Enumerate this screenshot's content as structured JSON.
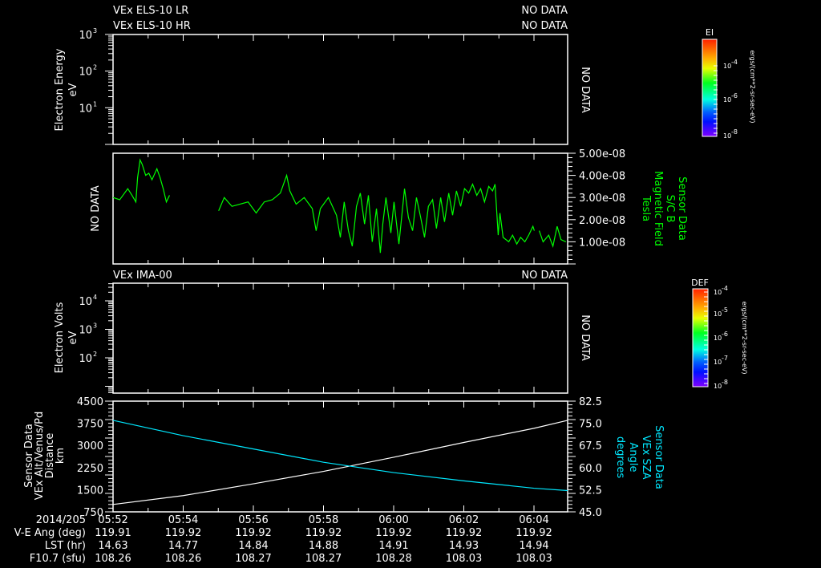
{
  "colors": {
    "background": "#000000",
    "axis": "#ffffff",
    "bfield": "#00ff00",
    "sza": "#00e8ff",
    "altitude": "#ffffff"
  },
  "panel1": {
    "title1": "VEx ELS-10 LR",
    "status1": "NO DATA",
    "title2": "VEx ELS-10 HR",
    "status2": "NO DATA",
    "ylabel": "Electron Energy",
    "yunit": "eV",
    "yticks": [
      {
        "base": "10",
        "exp": "3",
        "value": 1000
      },
      {
        "base": "10",
        "exp": "2",
        "value": 100
      },
      {
        "base": "10",
        "exp": "1",
        "value": 10
      }
    ],
    "ylim": [
      1,
      1000
    ],
    "nodata": "NO DATA",
    "colorbar": {
      "title": "EI",
      "unit": "ergs/(cm**2-sr-sec-eV)",
      "ticks": [
        {
          "base": "10",
          "exp": "-4"
        },
        {
          "base": "10",
          "exp": "-6"
        },
        {
          "base": "10",
          "exp": "-8"
        }
      ]
    }
  },
  "panel2": {
    "nodata_left": "NO DATA",
    "ylabels": [
      "Sensor Data",
      "S/C B",
      "Magnetic Field",
      "Tesla"
    ],
    "yticks": [
      "5.00e-08",
      "4.00e-08",
      "3.00e-08",
      "2.00e-08",
      "1.00e-08"
    ],
    "ytick_values": [
      5e-08,
      4e-08,
      3e-08,
      2e-08,
      1e-08
    ]
  },
  "panel3": {
    "title": "VEx IMA-00",
    "status": "NO DATA",
    "ylabel": "Electron Volts",
    "yunit": "eV",
    "yticks": [
      {
        "base": "10",
        "exp": "4",
        "value": 10000
      },
      {
        "base": "10",
        "exp": "3",
        "value": 1000
      },
      {
        "base": "10",
        "exp": "2",
        "value": 100
      }
    ],
    "nodata": "NO DATA",
    "colorbar": {
      "title": "DEF",
      "unit": "ergs/(cm**2-sr-sec-eV)",
      "ticks": [
        {
          "base": "10",
          "exp": "-4"
        },
        {
          "base": "10",
          "exp": "-5"
        },
        {
          "base": "10",
          "exp": "-6"
        },
        {
          "base": "10",
          "exp": "-7"
        },
        {
          "base": "10",
          "exp": "-8"
        }
      ]
    }
  },
  "panel4": {
    "ylabels_left": [
      "Sensor Data",
      "VEx Alt/Venus/Pd",
      "Distance",
      "km"
    ],
    "ylabels_right": [
      "Sensor Data",
      "VEx SZA",
      "Angle",
      "degrees"
    ],
    "yticks_left": [
      "4500",
      "3750",
      "3000",
      "2250",
      "1500",
      "750"
    ],
    "yticks_right": [
      "82.5",
      "75.0",
      "67.5",
      "60.0",
      "52.5",
      "45.0"
    ]
  },
  "xaxis": {
    "row_labels": [
      "2014/205",
      "V-E Ang (deg)",
      "LST (hr)",
      "F10.7 (sfu)"
    ],
    "times": [
      "05:52",
      "05:54",
      "05:56",
      "05:58",
      "06:00",
      "06:02",
      "06:04"
    ],
    "ve_ang": [
      "119.91",
      "119.92",
      "119.92",
      "119.92",
      "119.92",
      "119.92",
      "119.92"
    ],
    "lst": [
      "14.63",
      "14.77",
      "14.84",
      "14.88",
      "14.91",
      "14.93",
      "14.94"
    ],
    "f107": [
      "108.26",
      "108.26",
      "108.27",
      "108.27",
      "108.28",
      "108.03",
      "108.03"
    ]
  },
  "chart_data": [
    {
      "type": "heatmap",
      "title": "VEx ELS-10 LR / HR",
      "ylabel": "Electron Energy (eV)",
      "ylim": [
        1,
        1000
      ],
      "yscale": "log",
      "status": "NO DATA"
    },
    {
      "type": "line",
      "title": "S/C B Magnetic Field",
      "ylabel": "Tesla",
      "ylim": [
        0,
        5e-08
      ],
      "xunit": "minutes since 05:52",
      "xlim": [
        0,
        12.96
      ],
      "segments": [
        {
          "x": [
            0,
            0.19,
            0.42,
            0.54,
            0.65,
            0.7,
            0.77,
            0.83,
            0.93,
            1.02,
            1.11,
            1.25,
            1.34,
            1.43,
            1.52,
            1.61
          ],
          "y": [
            3e-08,
            2.9e-08,
            3.4e-08,
            3.1e-08,
            2.8e-08,
            3.9e-08,
            4.7e-08,
            4.5e-08,
            4e-08,
            4.1e-08,
            3.8e-08,
            4.3e-08,
            3.9e-08,
            3.4e-08,
            2.8e-08,
            3.1e-08
          ]
        },
        {
          "x": [
            3.01,
            3.17,
            3.39,
            3.62,
            3.85,
            4.08,
            4.31,
            4.54,
            4.77,
            4.95,
            5.04,
            5.22,
            5.45,
            5.68,
            5.79,
            5.91,
            6.14,
            6.37,
            6.48,
            6.59,
            6.71,
            6.82,
            6.94,
            7.05,
            7.17,
            7.28,
            7.39,
            7.51,
            7.62,
            7.69,
            7.78,
            7.92,
            8.01,
            8.15,
            8.31,
            8.42,
            8.54,
            8.65,
            8.77,
            8.88,
            8.99,
            9.11,
            9.22,
            9.34,
            9.45,
            9.57,
            9.68,
            9.79,
            9.91,
            10.02,
            10.14,
            10.25,
            10.37,
            10.48,
            10.59,
            10.71,
            10.82,
            10.89,
            10.98,
            11.03,
            11.12,
            11.28,
            11.39,
            11.51,
            11.62,
            11.74,
            11.85,
            11.97,
            12.01
          ],
          "y": [
            2.4e-08,
            3e-08,
            2.6e-08,
            2.7e-08,
            2.8e-08,
            2.3e-08,
            2.8e-08,
            2.9e-08,
            3.2e-08,
            4e-08,
            3.3e-08,
            2.7e-08,
            3e-08,
            2.5e-08,
            1.5e-08,
            2.5e-08,
            3e-08,
            2.2e-08,
            1.2e-08,
            2.8e-08,
            1.5e-08,
            8e-09,
            2.6e-08,
            3.2e-08,
            1.8e-08,
            3.1e-08,
            1e-08,
            2.5e-08,
            5e-09,
            1.8e-08,
            3e-08,
            1.4e-08,
            2.8e-08,
            9e-09,
            3.4e-08,
            2.1e-08,
            1.5e-08,
            3e-08,
            2.1e-08,
            1.2e-08,
            2.6e-08,
            2.9e-08,
            1.6e-08,
            3e-08,
            1.9e-08,
            3.2e-08,
            2.2e-08,
            3.3e-08,
            2.6e-08,
            3.4e-08,
            3.2e-08,
            3.6e-08,
            3.1e-08,
            3.4e-08,
            2.8e-08,
            3.5e-08,
            3.3e-08,
            3.6e-08,
            1.3e-08,
            2.3e-08,
            1.2e-08,
            1e-08,
            1.3e-08,
            9e-09,
            1.2e-08,
            1e-08,
            1.3e-08,
            1.7e-08,
            1.5e-08
          ]
        },
        {
          "x": [
            12.15,
            12.26,
            12.42,
            12.54,
            12.66,
            12.77,
            12.91
          ],
          "y": [
            1.5e-08,
            1e-08,
            1.3e-08,
            8e-09,
            1.7e-08,
            1.1e-08,
            1e-08
          ]
        }
      ]
    },
    {
      "type": "heatmap",
      "title": "VEx IMA-00",
      "ylabel": "Electron Volts (eV)",
      "yscale": "log",
      "status": "NO DATA"
    },
    {
      "type": "line",
      "title": "VEx Alt/Venus/Pd & VEx SZA",
      "xunit": "minutes since 05:52",
      "xlim": [
        0,
        12.96
      ],
      "series": [
        {
          "name": "VEx Alt/Venus/Pd Distance (km)",
          "axis": "left",
          "ylim": [
            750,
            4500
          ],
          "x": [
            0,
            2,
            4,
            6,
            8,
            10,
            12,
            12.96
          ],
          "y": [
            1000,
            1300,
            1700,
            2120,
            2600,
            3100,
            3580,
            3850
          ]
        },
        {
          "name": "VEx SZA Angle (degrees)",
          "axis": "right",
          "ylim": [
            45,
            82.5
          ],
          "x": [
            0,
            2,
            4,
            6,
            8,
            10,
            12,
            12.96
          ],
          "y": [
            76.0,
            70.8,
            66.3,
            61.8,
            58.3,
            55.5,
            53.0,
            52.2
          ]
        }
      ]
    }
  ]
}
